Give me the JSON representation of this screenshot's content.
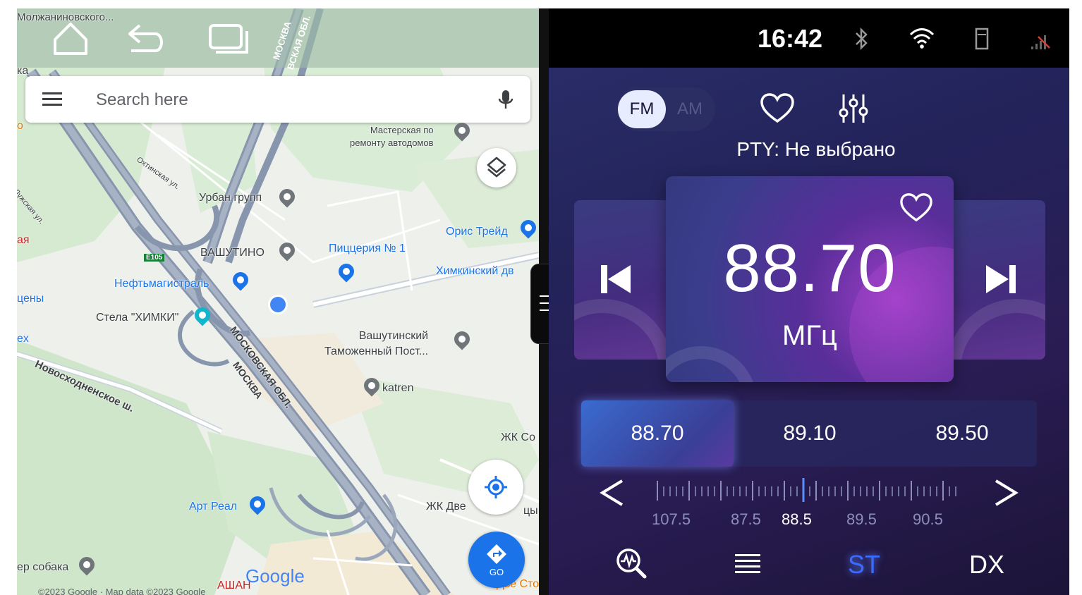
{
  "map": {
    "search_placeholder": "Search here",
    "labels": {
      "molzhaninovskogo": "Молжаниновского...",
      "master_shop": "Мастерская по\nремонту автодомов",
      "okhtinskaya": "Охтинская ул.",
      "luzhskaya": "Лужская ул.",
      "urban": "Урбан групп",
      "oris": "Орис Трейд",
      "vashutino": "ВАШУТИНО",
      "pizzeria": "Пиццерия № 1",
      "khimki_dv": "Химкинский дв",
      "neftemagistral": "Нефтьмагистраль",
      "stela": "Стела \"ХИМКИ\"",
      "customs": "Вашутинский\nТаможенный Пост...",
      "katren": "katren",
      "novoskhodnenskoe": "Новосходненское ш.",
      "moskovskaya_obl_1": "МОСКОВСКАЯ ОБЛ.",
      "moskva_1": "МОСКВА",
      "moskva_top": "МОСКВА",
      "obl_top": "ВСКАЯ ОБЛ.",
      "zhk_co": "ЖК Со",
      "art_real": "Арт Реал",
      "zhk_dve": "ЖК Две",
      "zhk_dve_2": "цы",
      "sobaka": "ер собака",
      "ashan": "АШАН",
      "dve_stol": "Две Столи",
      "ka": "ка",
      "ya": "ая",
      "tseny": "цены",
      "ex": "ex",
      "o": "о",
      "e105": "E105"
    },
    "google_logo": "Google",
    "go_label": "GO",
    "copyright": "©2023 Google · Map data ©2023 Google",
    "icons": {
      "home": "home-icon",
      "back": "back-icon",
      "recents": "recents-icon",
      "menu": "menu-icon",
      "mic": "mic-icon",
      "layers": "layers-icon",
      "locate": "my-location-icon",
      "directions": "directions-icon"
    }
  },
  "radio": {
    "status": {
      "time": "16:42",
      "icons": [
        "bluetooth-icon",
        "wifi-icon",
        "sd-card-icon",
        "signal-icon"
      ]
    },
    "band": {
      "fm": "FM",
      "am": "AM",
      "selected": "FM"
    },
    "pty": "PTY: Не выбрано",
    "frequency": "88.70",
    "unit": "МГц",
    "presets": [
      {
        "label": "88.70",
        "active": true
      },
      {
        "label": "89.10",
        "active": false
      },
      {
        "label": "89.50",
        "active": false
      }
    ],
    "scale_labels": [
      {
        "label": "107.5",
        "current": false
      },
      {
        "label": "87.5",
        "current": false
      },
      {
        "label": "88.5",
        "current": true
      },
      {
        "label": "89.5",
        "current": false
      },
      {
        "label": "90.5",
        "current": false
      }
    ],
    "bottom": {
      "st": "ST",
      "dx": "DX"
    },
    "colors": {
      "accent": "#3a6bff",
      "background": "#23235a",
      "preset_active": "#3a6bd0"
    }
  }
}
